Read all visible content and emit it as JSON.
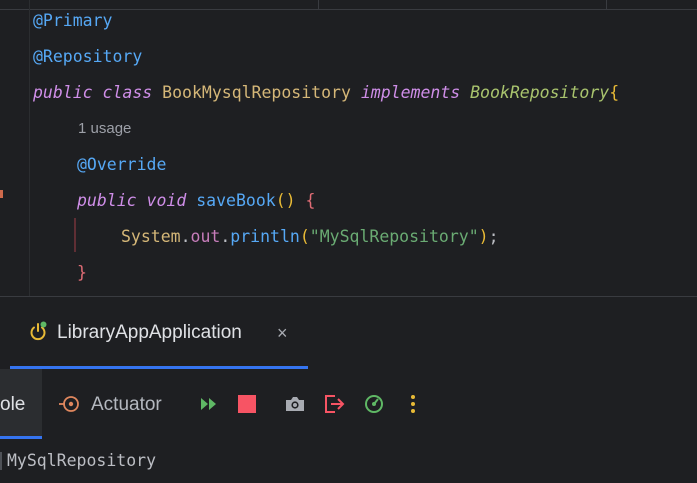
{
  "editor": {
    "line1": {
      "annotation": "@Primary"
    },
    "line2": {
      "annotation": "@Repository"
    },
    "line3": {
      "kw_public": "public",
      "kw_class": "class",
      "class_name": "BookMysqlRepository",
      "kw_implements": "implements",
      "interface_name": "BookRepository",
      "open_brace": "{"
    },
    "usage_hint": "1 usage",
    "line5": {
      "annotation": "@Override"
    },
    "line6": {
      "kw_public": "public",
      "kw_void": "void",
      "method_name": "saveBook",
      "parens": "()",
      "open_brace": "{"
    },
    "line7": {
      "class_ref": "System",
      "dot1": ".",
      "field": "out",
      "dot2": ".",
      "method": "println",
      "paren_open": "(",
      "string": "\"MySqlRepository\"",
      "paren_close": ")",
      "semicolon": ";"
    },
    "line8": {
      "close_brace": "}"
    }
  },
  "run_panel": {
    "tab_title": "LibraryAppApplication",
    "close_symbol": "×",
    "toolbar": {
      "console_label": "ole",
      "actuator_label": "Actuator",
      "icons": [
        "rerun-icon",
        "stop-icon",
        "camera-icon",
        "exit-icon",
        "profiler-icon",
        "more-icon"
      ]
    },
    "console_output": "MySqlRepository"
  },
  "colors": {
    "background": "#1e1f22",
    "accent": "#3574f0",
    "keyword": "#cf8ee8",
    "annotation": "#56a8f5",
    "string": "#6aab73",
    "stop": "#f75464",
    "run_green": "#5fb865"
  }
}
